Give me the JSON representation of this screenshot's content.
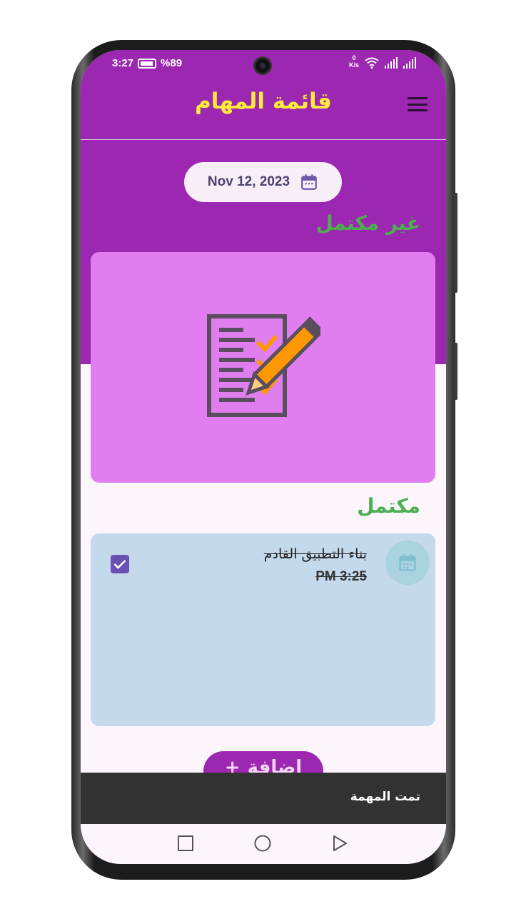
{
  "status_bar": {
    "time": "3:27",
    "battery": "%89",
    "net_speed_value": "0",
    "net_speed_unit": "K/s"
  },
  "app_bar": {
    "title": "قائمة المهام",
    "menu_icon": "hamburger-menu-icon"
  },
  "date_picker": {
    "date": "Nov 12, 2023",
    "icon": "calendar-icon"
  },
  "sections": {
    "pending_label": "غير مكتمل",
    "completed_label": "مكتمل"
  },
  "completed_tasks": [
    {
      "title": "بناء التطبيق القادم",
      "time": "PM 3:25",
      "checked": true,
      "icon": "calendar-icon"
    }
  ],
  "add_button": {
    "label": "اضافة",
    "icon": "plus-icon"
  },
  "snackbar": {
    "message": "تمت المهمة"
  },
  "colors": {
    "primary": "#9c27b0",
    "title": "#ffeb3b",
    "section_label": "#4caf50",
    "empty_card": "#e07ef0",
    "task_card": "#c5d9ed",
    "checkbox": "#6c4fb3"
  }
}
